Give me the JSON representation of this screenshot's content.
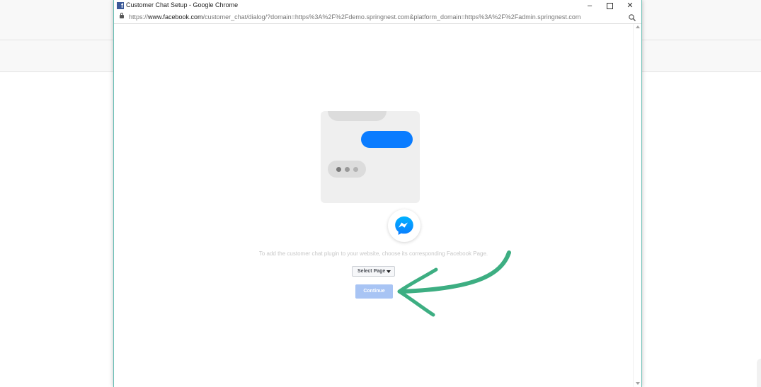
{
  "window": {
    "title": "Customer Chat Setup - Google Chrome",
    "favicon_letter": "f",
    "controls": {
      "minimize": "–",
      "close": "✕"
    }
  },
  "address_bar": {
    "url_prefix": "https://",
    "url_host": "www.facebook.com",
    "url_path": "/customer_chat/dialog/?domain=https%3A%2F%2Fdemo.springnest.com&platform_domain=https%3A%2F%2Fadmin.springnest.com",
    "zoom_icon": "magnifier-icon",
    "lock_icon": "lock-icon"
  },
  "dialog": {
    "instruction": "To add the customer chat plugin to your website, choose its corresponding Facebook Page.",
    "select_page_label": "Select Page",
    "continue_label": "Continue",
    "continue_enabled": false
  },
  "colors": {
    "messenger_blue": "#0a7cff",
    "continue_disabled": "#a8c4f4",
    "annotation_arrow": "#3dae82",
    "window_border": "#6bbfb6"
  },
  "annotation": {
    "icon": "green-arrow-icon"
  }
}
